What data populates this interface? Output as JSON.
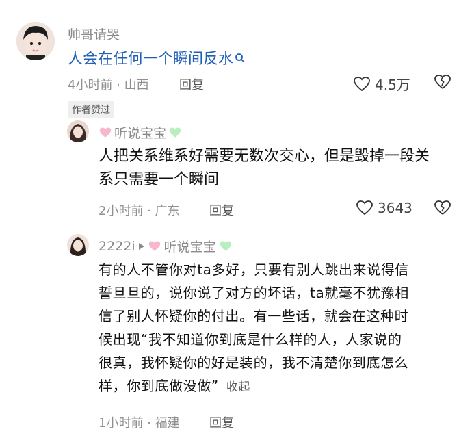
{
  "top": {
    "username": "帅哥请哭",
    "comment": "人会在任何一个瞬间反水",
    "meta": "4小时前 · 山西",
    "reply_label": "回复",
    "likes": "4.5万",
    "author_tag": "作者赞过"
  },
  "reply1": {
    "username": "听说宝宝",
    "text_line1": "人把关系维系好需要无数次交心，但是毁掉一段关",
    "text_line2": "系只需要一个瞬间",
    "meta": "2小时前 · 广东",
    "reply_label": "回复",
    "likes": "3643"
  },
  "reply2": {
    "from_user": "2222i",
    "to_user": "听说宝宝",
    "lines": [
      "有的人不管你对ta多好，只要有别人跳出来说得信",
      "誓旦旦的，说你说了对方的坏话，ta就毫不犹豫相",
      "信了别人怀疑你的付出。有一些话，就会在这种时",
      "候出现“我不知道你到底是什么样的人，人家说的",
      "很真，我怀疑你的好是装的，我不清楚你到底怎么"
    ],
    "last_line": "样，你到底做没做”",
    "collapse_label": "收起",
    "meta": "1小时前 · 福建",
    "reply_label": "回复"
  },
  "colors": {
    "link": "#1f5fb8",
    "heart_pink": "#f7b7cf",
    "heart_green": "#b9eec1"
  },
  "icons": [
    "search-icon",
    "heart-outline-icon",
    "broken-heart-icon",
    "play-triangle-icon"
  ]
}
